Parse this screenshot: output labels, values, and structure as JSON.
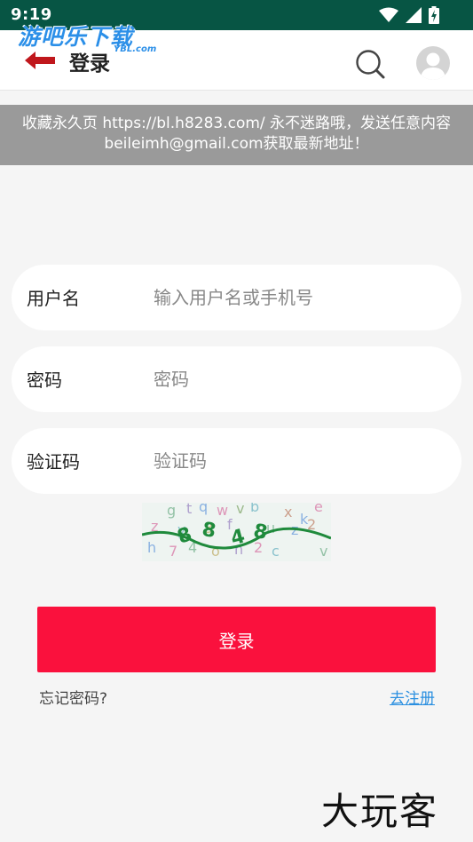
{
  "status_bar": {
    "time": "9:19",
    "icons": [
      "wifi-icon",
      "signal-icon",
      "battery-charging-icon"
    ],
    "background": "#075544"
  },
  "watermark": {
    "main": "游吧乐下载",
    "sub": "YBL.com",
    "color": "#2b8fe8"
  },
  "nav": {
    "title": "登录",
    "back_icon": "back-arrow-icon",
    "search_icon": "search-icon",
    "avatar_icon": "user-avatar-icon",
    "back_color": "#c0171c"
  },
  "notice": {
    "text": "收藏永久页 https://bl.h8283.com/ 永不迷路哦，发送任意内容beileimh@gmail.com获取最新地址！"
  },
  "form": {
    "username": {
      "label": "用户名",
      "placeholder": "输入用户名或手机号",
      "value": ""
    },
    "password": {
      "label": "密码",
      "placeholder": "密码",
      "value": ""
    },
    "captcha": {
      "label": "验证码",
      "placeholder": "验证码",
      "value": ""
    },
    "captcha_image": "captcha-image"
  },
  "actions": {
    "login_label": "登录",
    "login_color": "#fa113d",
    "forgot_label": "忘记密码?",
    "register_label": "去注册",
    "register_color": "#2a8fe0"
  },
  "brand": {
    "text": "大玩客"
  }
}
